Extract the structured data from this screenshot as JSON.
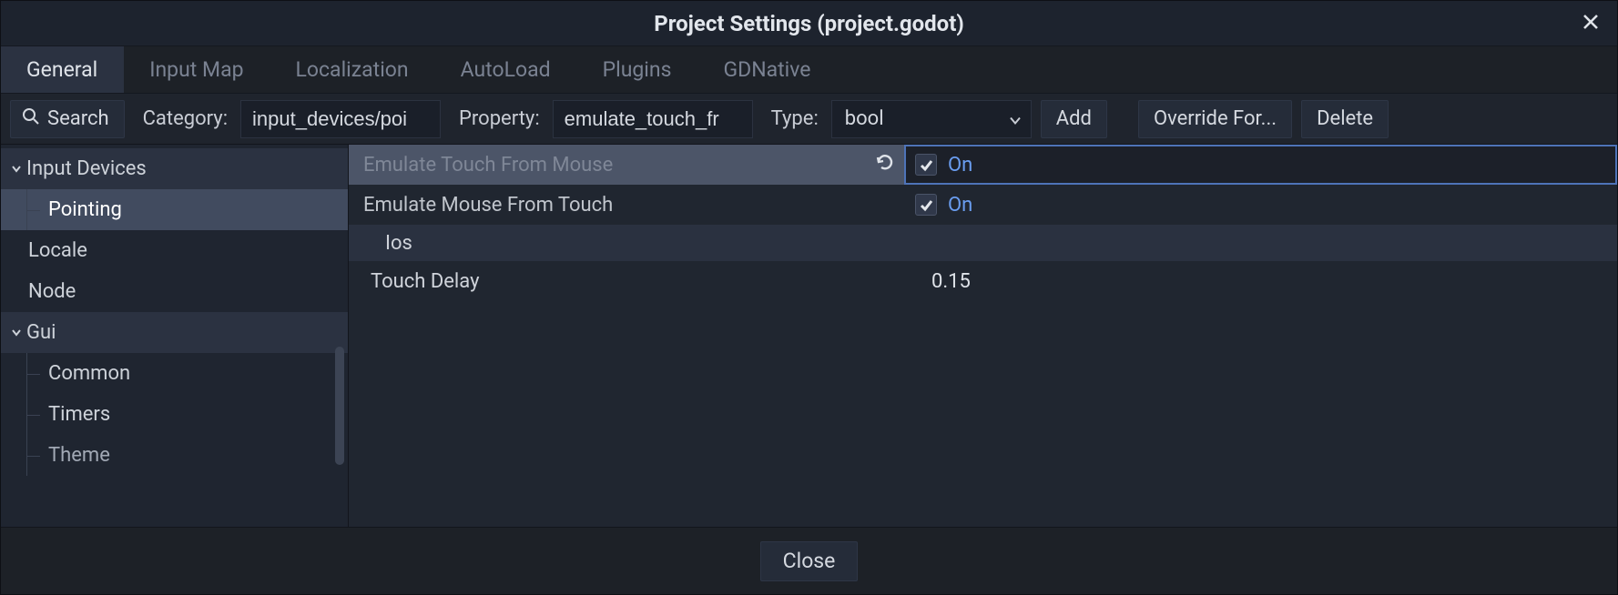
{
  "window": {
    "title": "Project Settings (project.godot)"
  },
  "tabs": [
    {
      "label": "General",
      "active": true
    },
    {
      "label": "Input Map",
      "active": false
    },
    {
      "label": "Localization",
      "active": false
    },
    {
      "label": "AutoLoad",
      "active": false
    },
    {
      "label": "Plugins",
      "active": false
    },
    {
      "label": "GDNative",
      "active": false
    }
  ],
  "toolbar": {
    "search_label": "Search",
    "category_label": "Category:",
    "category_value": "input_devices/poi",
    "property_label": "Property:",
    "property_value": "emulate_touch_fr",
    "type_label": "Type:",
    "type_value": "bool",
    "add_label": "Add",
    "override_label": "Override For...",
    "delete_label": "Delete"
  },
  "sidebar": {
    "items": [
      {
        "label": "Input Devices",
        "kind": "group",
        "expanded": true,
        "children": [
          {
            "label": "Pointing",
            "selected": true
          }
        ]
      },
      {
        "label": "Locale",
        "kind": "leaf"
      },
      {
        "label": "Node",
        "kind": "leaf"
      },
      {
        "label": "Gui",
        "kind": "group",
        "expanded": true,
        "children": [
          {
            "label": "Common"
          },
          {
            "label": "Timers"
          },
          {
            "label": "Theme",
            "cutoff": true
          }
        ]
      }
    ]
  },
  "properties": {
    "rows": [
      {
        "label": "Emulate Touch From Mouse",
        "type": "bool",
        "value": "On",
        "checked": true,
        "highlight": true,
        "revert": true
      },
      {
        "label": "Emulate Mouse From Touch",
        "type": "bool",
        "value": "On",
        "checked": true
      },
      {
        "label": "Ios",
        "type": "section"
      },
      {
        "label": "Touch Delay",
        "type": "plain",
        "value": "0.15"
      }
    ]
  },
  "footer": {
    "close_label": "Close"
  }
}
